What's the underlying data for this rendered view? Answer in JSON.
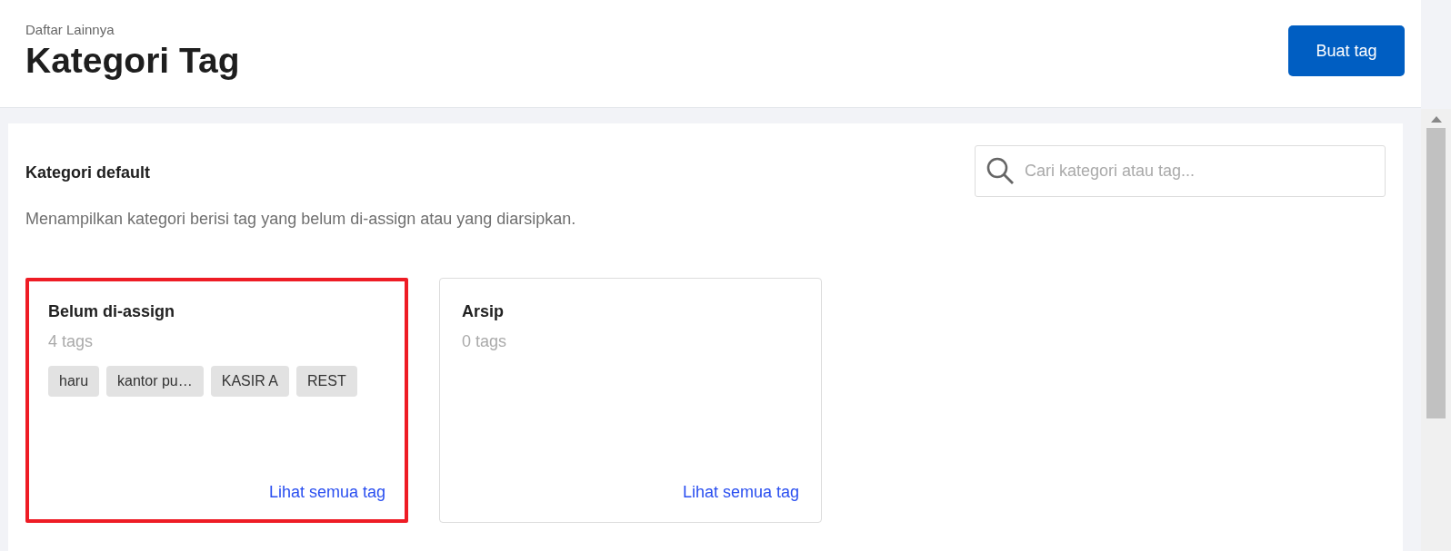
{
  "header": {
    "breadcrumb": "Daftar Lainnya",
    "title": "Kategori Tag",
    "button": "Buat tag"
  },
  "section": {
    "title": "Kategori default",
    "description": "Menampilkan kategori berisi tag yang belum di-assign atau yang diarsipkan.",
    "search": {
      "placeholder": "Cari kategori atau tag..."
    }
  },
  "cards": [
    {
      "title": "Belum di-assign",
      "count": "4 tags",
      "highlighted": true,
      "tags": [
        "haru",
        "kantor pu…",
        "KASIR A",
        "REST"
      ],
      "link": "Lihat semua tag"
    },
    {
      "title": "Arsip",
      "count": "0 tags",
      "highlighted": false,
      "link": "Lihat semua tag"
    }
  ]
}
